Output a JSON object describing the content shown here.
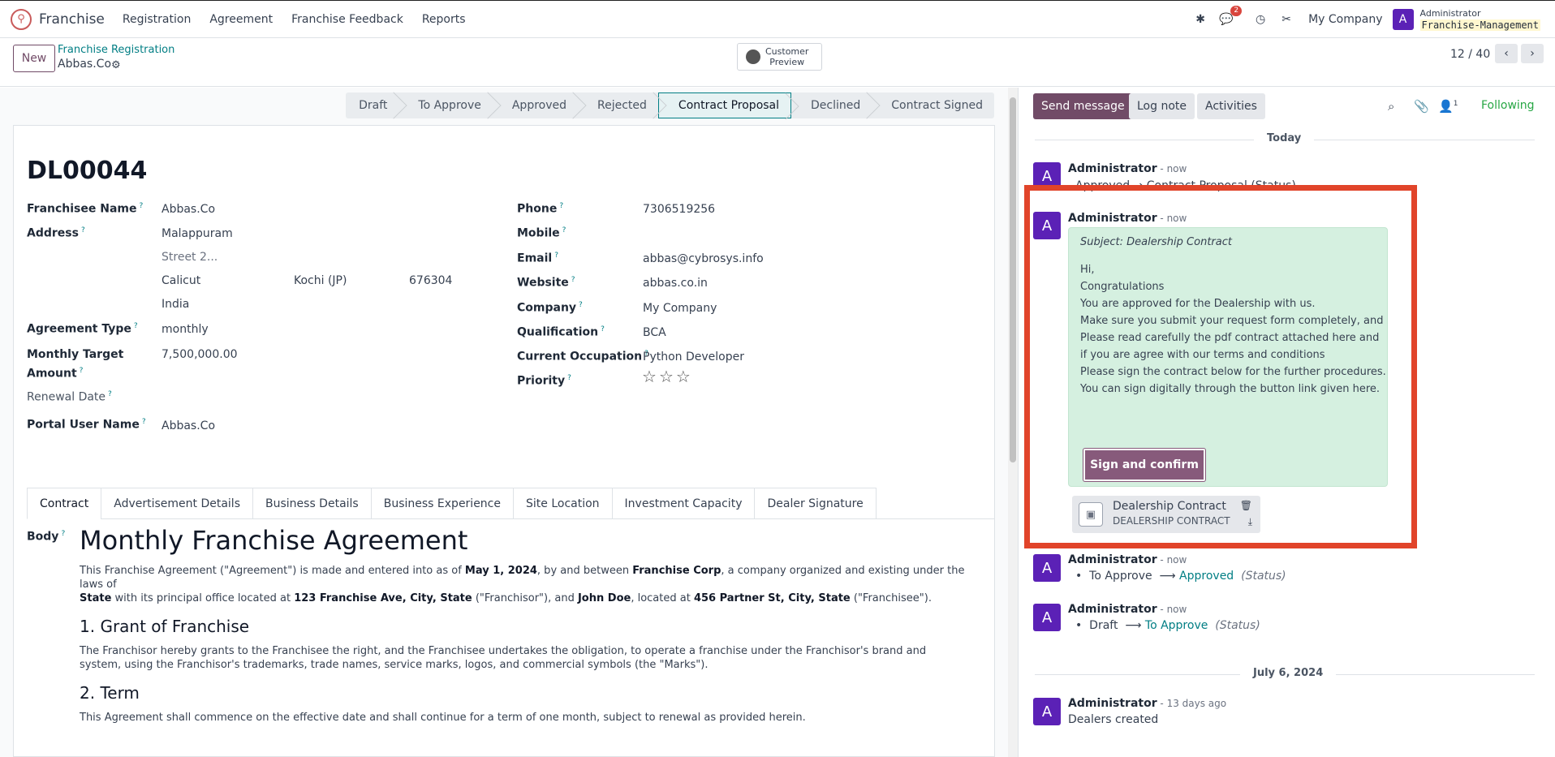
{
  "navbar": {
    "app_name": "Franchise",
    "menu": [
      "Registration",
      "Agreement",
      "Franchise Feedback",
      "Reports"
    ],
    "chat_badge": "2",
    "company": "My Company",
    "user_initial": "A",
    "user_name": "Administrator",
    "database": "Franchise-Management"
  },
  "control": {
    "new_label": "New",
    "breadcrumb_parent": "Franchise Registration",
    "breadcrumb_current": "Abbas.Co",
    "customer_preview": [
      "Customer",
      "Preview"
    ],
    "pager": "12 / 40"
  },
  "statusbar": {
    "stages": [
      "Draft",
      "To Approve",
      "Approved",
      "Rejected",
      "Contract Proposal",
      "Declined",
      "Contract Signed"
    ],
    "active": "Contract Proposal"
  },
  "form": {
    "record_name": "DL00044",
    "left": {
      "franchisee_name_label": "Franchisee Name",
      "franchisee_name": "Abbas.Co",
      "address_label": "Address",
      "street": "Malappuram",
      "street2_placeholder": "Street 2...",
      "city": "Calicut",
      "state": "Kochi (JP)",
      "zip": "676304",
      "country": "India",
      "agreement_type_label": "Agreement Type",
      "agreement_type": "monthly",
      "monthly_target_label_1": "Monthly Target",
      "monthly_target_label_2": "Amount",
      "monthly_target": "7,500,000.00",
      "renewal_date_label": "Renewal Date",
      "portal_user_label": "Portal User Name",
      "portal_user": "Abbas.Co"
    },
    "right": {
      "phone_label": "Phone",
      "phone": "7306519256",
      "mobile_label": "Mobile",
      "email_label": "Email",
      "email": "abbas@cybrosys.info",
      "website_label": "Website",
      "website": "abbas.co.in",
      "company_label": "Company",
      "company": "My Company",
      "qualification_label": "Qualification",
      "qualification": "BCA",
      "occupation_label": "Current Occupation",
      "occupation": "Python Developer",
      "priority_label": "Priority",
      "priority": 0
    },
    "tabs": [
      "Contract",
      "Advertisement Details",
      "Business Details",
      "Business Experience",
      "Site Location",
      "Investment Capacity",
      "Dealer Signature"
    ],
    "body_label": "Body",
    "doc": {
      "title": "Monthly Franchise Agreement",
      "p1_a": "This Franchise Agreement (\"Agreement\") is made and entered into as of ",
      "p1_date": "May 1, 2024",
      "p1_b": ", by and between ",
      "p1_corp": "Franchise Corp",
      "p1_c": ", a company organized and existing under the laws of",
      "p1_state": "State",
      "p1_d": " with its principal office located at ",
      "p1_addr": "123 Franchise Ave, City, State",
      "p1_e": " (\"Franchisor\"), and ",
      "p1_doe": "John Doe",
      "p1_f": ", located at ",
      "p1_addr2": "456 Partner St, City, State",
      "p1_g": " (\"Franchisee\").",
      "h2_1": "1. Grant of Franchise",
      "p2": "The Franchisor hereby grants to the Franchisee the right, and the Franchisee undertakes the obligation, to operate a franchise under the Franchisor's brand and system, using the Franchisor's trademarks, trade names, service marks, logos, and commercial symbols (the \"Marks\").",
      "h2_2": "2. Term",
      "p3": "This Agreement shall commence on the effective date and shall continue for a term of one month, subject to renewal as provided herein."
    }
  },
  "chatter": {
    "send_message": "Send message",
    "log_note": "Log note",
    "activities": "Activities",
    "followers_count": "1",
    "following": "Following",
    "today": "Today",
    "msg1": {
      "author": "Administrator",
      "time": " - now",
      "line": "Approved → Contract Proposal (Status)"
    },
    "msg2": {
      "author": "Administrator",
      "time": " - now",
      "subject": "Subject: Dealership Contract",
      "lines": [
        "Hi,",
        "Congratulations",
        "You are approved for the Dealership with us.",
        "Make sure you submit your request form completely, and",
        "Please read carefully the pdf contract attached here and",
        "if you are agree with our terms and conditions",
        "Please sign the contract below for the further procedures.",
        "You can sign digitally through the button link given here."
      ],
      "button": "Sign and confirm",
      "attachment_name": "Dealership Contract",
      "attachment_ext": "DEALERSHIP CONTRACT"
    },
    "msg3": {
      "author": "Administrator",
      "time": " - now",
      "old": "To Approve",
      "new": "Approved",
      "field": "(Status)"
    },
    "msg4": {
      "author": "Administrator",
      "time": " - now",
      "old": "Draft",
      "new": "To Approve",
      "field": "(Status)"
    },
    "date2": "July 6, 2024",
    "msg5": {
      "author": "Administrator",
      "time": " - 13 days ago",
      "line": "Dealers created"
    }
  }
}
